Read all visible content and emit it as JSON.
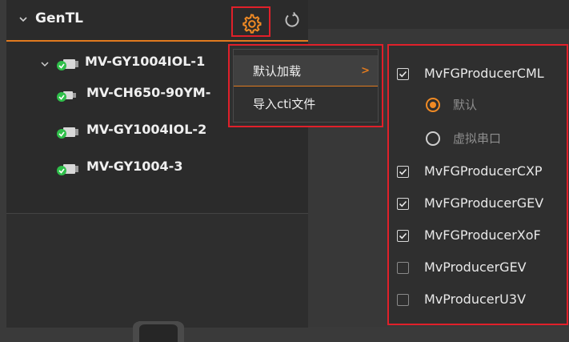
{
  "tree": {
    "root_label": "GenTL",
    "devices": [
      {
        "name": "MV-GY1004IOL-1",
        "expanded": true
      },
      {
        "name": "MV-CH650-90YM-"
      },
      {
        "name": "MV-GY1004IOL-2"
      },
      {
        "name": "MV-GY1004-3"
      }
    ]
  },
  "toolbar": {
    "settings_icon": "gear-icon",
    "refresh_icon": "refresh-icon"
  },
  "menu": {
    "items": [
      {
        "label": "默认加载",
        "has_submenu": true
      },
      {
        "label": "导入cti文件"
      }
    ]
  },
  "submenu": {
    "options": [
      {
        "label": "MvFGProducerCML",
        "checked": true
      },
      {
        "label": "MvFGProducerCXP",
        "checked": true
      },
      {
        "label": "MvFGProducerGEV",
        "checked": true
      },
      {
        "label": "MvFGProducerXoF",
        "checked": true
      },
      {
        "label": "MvProducerGEV",
        "checked": false
      },
      {
        "label": "MvProducerU3V",
        "checked": false
      }
    ],
    "cml_modes": [
      {
        "label": "默认",
        "selected": true
      },
      {
        "label": "虚拟串口",
        "selected": false
      }
    ]
  },
  "colors": {
    "accent": "#e07a1f",
    "highlight_border": "#e0202a",
    "status_ok": "#2fbf4a"
  }
}
